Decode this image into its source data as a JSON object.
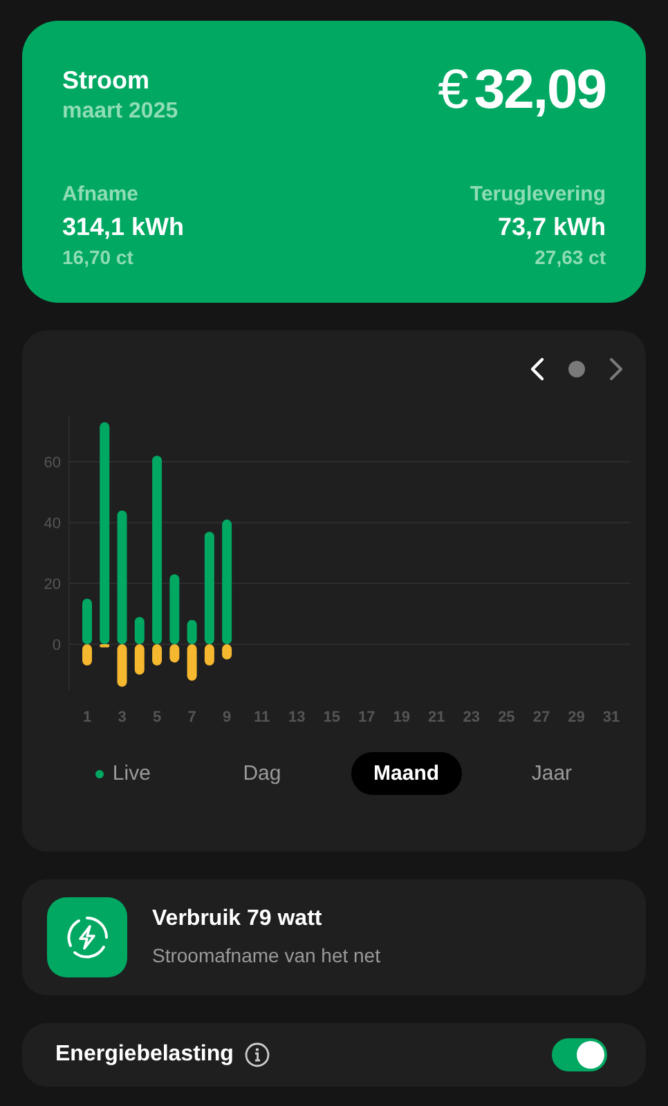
{
  "summary": {
    "title": "Stroom",
    "period": "maart 2025",
    "currency": "€",
    "amount": "32,09",
    "stats": [
      {
        "label": "Afname",
        "value": "314,1 kWh",
        "price": "16,70 ct"
      },
      {
        "label": "Teruglevering",
        "value": "73,7 kWh",
        "price": "27,63 ct"
      }
    ]
  },
  "chart": {
    "chart_data": {
      "type": "bar",
      "stacked": true,
      "x": [
        1,
        2,
        3,
        4,
        5,
        6,
        7,
        8,
        9
      ],
      "xlim": [
        1,
        31
      ],
      "grid": true,
      "series": [
        {
          "color": "#00a862",
          "values": [
            15,
            73,
            44,
            9,
            62,
            23,
            8,
            37,
            41
          ]
        },
        {
          "color": "#f5b82e",
          "values": [
            -7,
            -1,
            -14,
            -10,
            -7,
            -6,
            -12,
            -7,
            -5
          ]
        }
      ],
      "xticks": [
        1,
        3,
        5,
        7,
        9,
        11,
        13,
        15,
        17,
        19,
        21,
        23,
        25,
        27,
        29,
        31
      ],
      "yticks": [
        0,
        20,
        40,
        60
      ],
      "ylim": [
        -15,
        75
      ]
    },
    "periods": [
      {
        "label": "Live",
        "selected": false,
        "kind": "live"
      },
      {
        "label": "Dag",
        "selected": false,
        "kind": "plain"
      },
      {
        "label": "Maand",
        "selected": true,
        "kind": "plain"
      },
      {
        "label": "Jaar",
        "selected": false,
        "kind": "plain"
      }
    ]
  },
  "usage": {
    "title": "Verbruik 79 watt",
    "subtitle": "Stroomafname van het net"
  },
  "setting": {
    "label": "Energiebelasting",
    "on": true
  }
}
